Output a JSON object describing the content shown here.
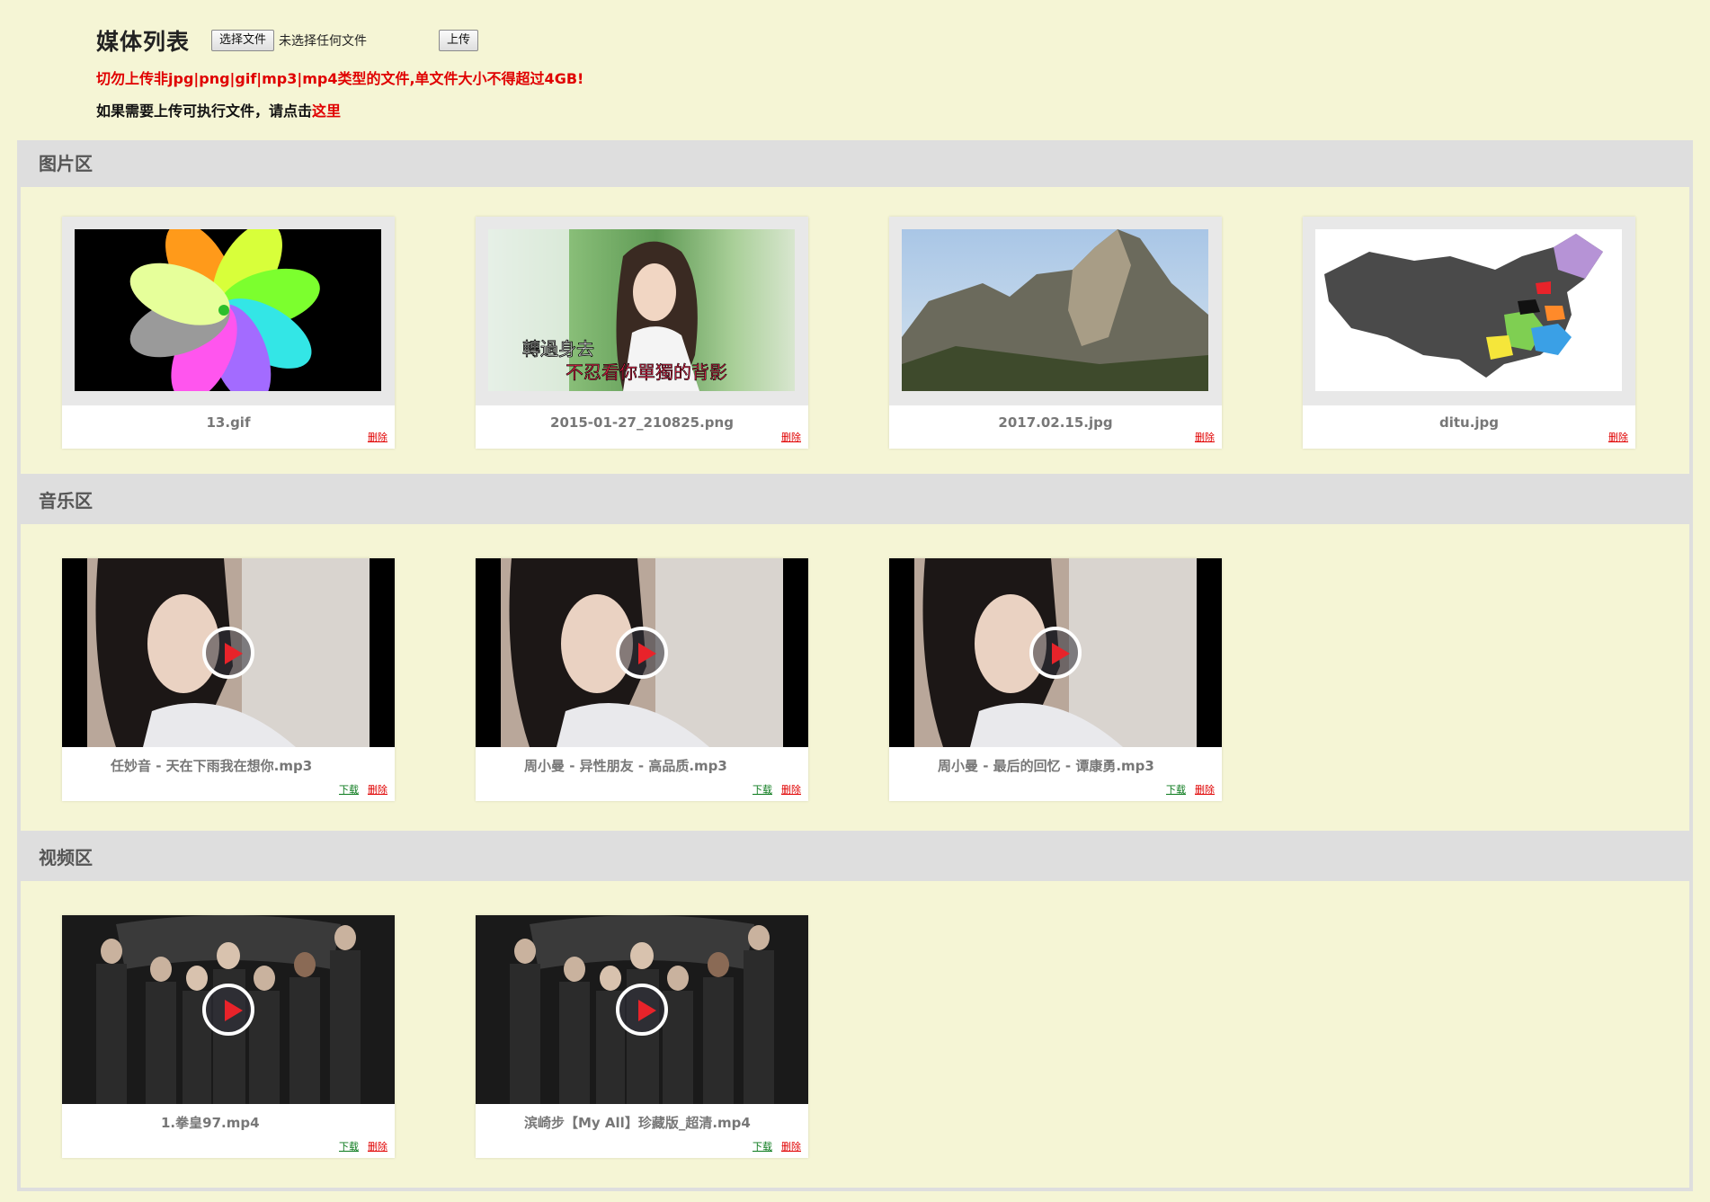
{
  "header": {
    "title": "媒体列表",
    "choose_file_label": "选择文件",
    "no_file_text": "未选择任何文件",
    "upload_label": "上传",
    "warning": "切勿上传非jpg|png|gif|mp3|mp4类型的文件,单文件大小不得超过4GB!",
    "exec_note": "如果需要上传可执行文件，请点击",
    "exec_link": "这里"
  },
  "sections": {
    "images": {
      "title": "图片区",
      "items": [
        {
          "name": "13.gif",
          "delete": "删除"
        },
        {
          "name": "2015-01-27_210825.png",
          "delete": "删除"
        },
        {
          "name": "2017.02.15.jpg",
          "delete": "删除"
        },
        {
          "name": "ditu.jpg",
          "delete": "删除"
        }
      ]
    },
    "music": {
      "title": "音乐区",
      "items": [
        {
          "name": "任妙音 - 天在下雨我在想你.mp3",
          "download": "下载",
          "delete": "删除"
        },
        {
          "name": "周小曼 - 异性朋友 - 高品质.mp3",
          "download": "下载",
          "delete": "删除"
        },
        {
          "name": "周小曼 - 最后的回忆 - 谭康勇.mp3",
          "download": "下载",
          "delete": "删除"
        }
      ]
    },
    "video": {
      "title": "视频区",
      "items": [
        {
          "name": "1.拳皇97.mp4",
          "download": "下载",
          "delete": "删除"
        },
        {
          "name": "滨崎步【My All】珍藏版_超清.mp4",
          "download": "下载",
          "delete": "删除"
        }
      ]
    }
  },
  "thumb_captions": {
    "lyric_line1": "轉過身去",
    "lyric_line2": "不忍看你單獨的背影"
  },
  "colors": {
    "background": "#f5f5d5",
    "section_header": "#dedede",
    "warning": "#e00000",
    "download_link": "#0b7a1c",
    "play_triangle": "#e8232a"
  }
}
